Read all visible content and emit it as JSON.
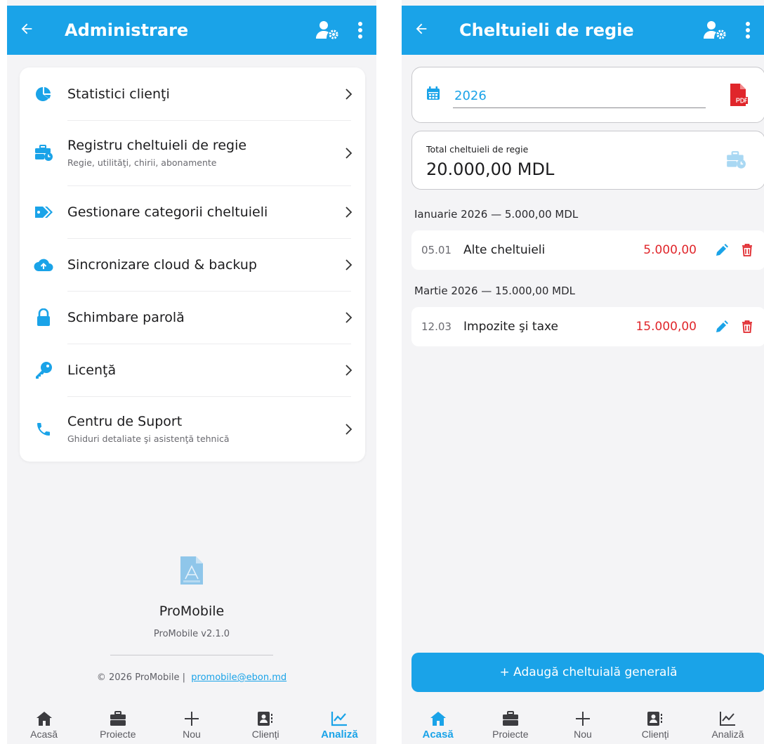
{
  "left": {
    "appbar": {
      "title": "Administrare"
    },
    "menu": [
      {
        "label": "Statistici clienţi",
        "icon": "pie-chart-icon"
      },
      {
        "label": "Registru cheltuieli de regie",
        "subtitle": "Regie, utilităţi, chirii, abonamente",
        "icon": "briefcase-clock-icon"
      },
      {
        "label": "Gestionare categorii cheltuieli",
        "icon": "tags-icon"
      },
      {
        "label": "Sincronizare cloud & backup",
        "icon": "cloud-upload-icon"
      },
      {
        "label": "Schimbare parolă",
        "icon": "lock-icon"
      },
      {
        "label": "Licenţă",
        "icon": "key-icon"
      },
      {
        "label": "Centru de Suport",
        "subtitle": "Ghiduri detaliate şi asistenţă tehnică",
        "icon": "phone-icon"
      }
    ],
    "about": {
      "app_name": "ProMobile",
      "version": "ProMobile v2.1.0",
      "copyright": "© 2026 ProMobile |",
      "email": "promobile@ebon.md"
    },
    "nav": [
      {
        "label": "Acasă",
        "icon": "home-icon",
        "active": false
      },
      {
        "label": "Proiecte",
        "icon": "briefcase-icon",
        "active": false
      },
      {
        "label": "Nou",
        "icon": "plus-icon",
        "active": false
      },
      {
        "label": "Clienți",
        "icon": "contacts-icon",
        "active": false
      },
      {
        "label": "Analiză",
        "icon": "chart-line-icon",
        "active": true
      }
    ]
  },
  "right": {
    "appbar": {
      "title": "Cheltuieli de regie"
    },
    "year": {
      "value": "2026"
    },
    "total": {
      "label": "Total cheltuieli de regie",
      "value": "20.000,00 MDL"
    },
    "groups": [
      {
        "header": "Ianuarie 2026 — 5.000,00 MDL",
        "rows": [
          {
            "date": "05.01",
            "description": "Alte cheltuieli",
            "amount": "5.000,00"
          }
        ]
      },
      {
        "header": "Martie 2026 — 15.000,00 MDL",
        "rows": [
          {
            "date": "12.03",
            "description": "Impozite şi taxe",
            "amount": "15.000,00"
          }
        ]
      }
    ],
    "add_button": "+ Adaugă cheltuială generală",
    "nav": [
      {
        "label": "Acasă",
        "icon": "home-icon",
        "active": true
      },
      {
        "label": "Proiecte",
        "icon": "briefcase-icon",
        "active": false
      },
      {
        "label": "Nou",
        "icon": "plus-icon",
        "active": false
      },
      {
        "label": "Clienți",
        "icon": "contacts-icon",
        "active": false
      },
      {
        "label": "Analiză",
        "icon": "chart-line-icon",
        "active": false
      }
    ]
  },
  "colors": {
    "primary": "#1aa3e8",
    "danger": "#e0262b",
    "background": "#f4f4f6"
  }
}
